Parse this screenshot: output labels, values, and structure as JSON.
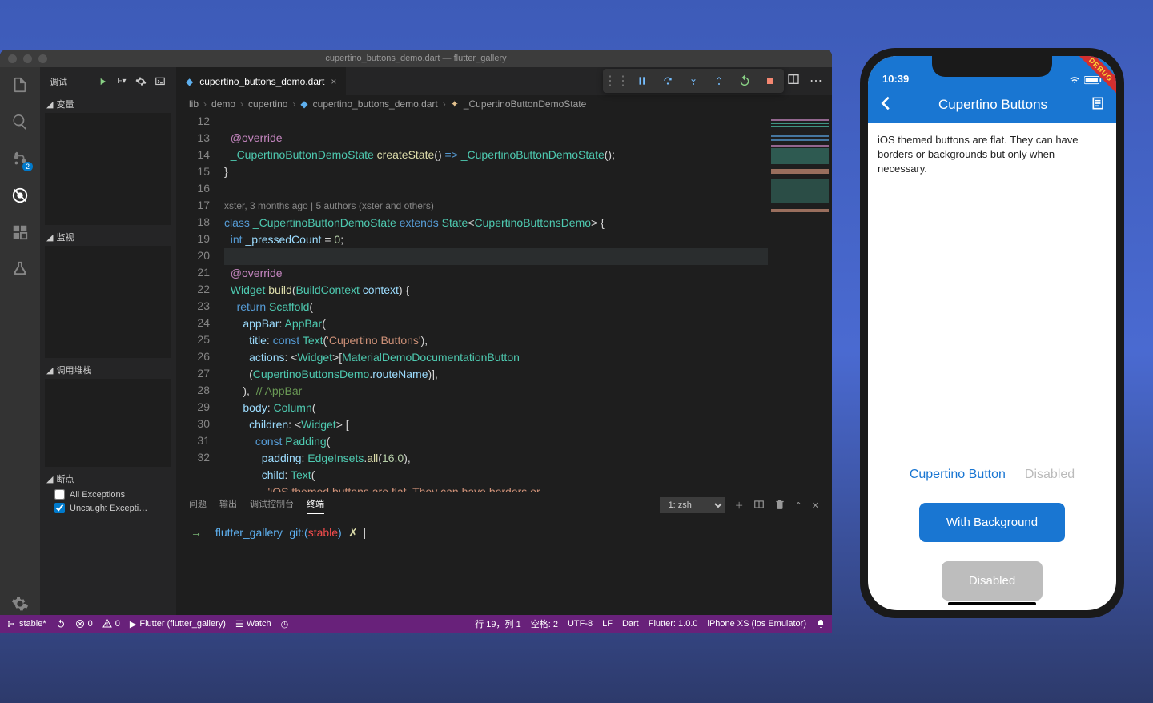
{
  "window": {
    "title": "cupertino_buttons_demo.dart — flutter_gallery"
  },
  "activitybar": {
    "scm_badge": "2"
  },
  "debug_sidebar": {
    "title": "调试",
    "sections": {
      "variables": "变量",
      "watch": "监视",
      "callstack": "调用堆栈",
      "breakpoints": "断点"
    },
    "breakpoint_items": [
      {
        "label": "All Exceptions",
        "checked": false
      },
      {
        "label": "Uncaught Excepti…",
        "checked": true
      }
    ]
  },
  "tab": {
    "filename": "cupertino_buttons_demo.dart"
  },
  "breadcrumbs": [
    "lib",
    "demo",
    "cupertino",
    "cupertino_buttons_demo.dart",
    "_CupertinoButtonDemoState"
  ],
  "codelens": "xster, 3 months ago | 5 authors (xster and others)",
  "code_lines": [
    {
      "n": 12,
      "html": ""
    },
    {
      "n": 13,
      "html": "  <span class='an'>@override</span>"
    },
    {
      "n": 14,
      "html": "  <span class='cls'>_CupertinoButtonDemoState</span> <span class='fn'>createState</span><span class='pn'>()</span> <span class='k'>=></span> <span class='cls'>_CupertinoButtonDemoState</span><span class='pn'>();</span>"
    },
    {
      "n": 15,
      "html": "<span class='pn'>}</span>"
    },
    {
      "n": 16,
      "html": ""
    },
    {
      "n": "lens",
      "html": "<span class='lens'>xster, 3 months ago | 5 authors (xster and others)</span>"
    },
    {
      "n": 17,
      "html": "<span class='k'>class</span> <span class='cls'>_CupertinoButtonDemoState</span> <span class='k'>extends</span> <span class='cls'>State</span><span class='pn'>&lt;</span><span class='cls'>CupertinoButtonsDemo</span><span class='pn'>&gt;</span> <span class='pn'>{</span>"
    },
    {
      "n": 18,
      "html": "  <span class='k'>int</span> <span class='id'>_pressedCount</span> <span class='pn'>=</span> <span class='num'>0</span><span class='pn'>;</span>"
    },
    {
      "n": 19,
      "html": "",
      "cursor": true
    },
    {
      "n": 20,
      "html": "  <span class='an'>@override</span>"
    },
    {
      "n": 21,
      "html": "  <span class='cls'>Widget</span> <span class='fn'>build</span><span class='pn'>(</span><span class='cls'>BuildContext</span> <span class='id'>context</span><span class='pn'>)</span> <span class='pn'>{</span>"
    },
    {
      "n": 22,
      "html": "    <span class='k'>return</span> <span class='cls'>Scaffold</span><span class='pn'>(</span>"
    },
    {
      "n": 23,
      "html": "      <span class='id'>appBar</span><span class='pn'>:</span> <span class='cls'>AppBar</span><span class='pn'>(</span>"
    },
    {
      "n": 24,
      "html": "        <span class='id'>title</span><span class='pn'>:</span> <span class='k'>const</span> <span class='cls'>Text</span><span class='pn'>(</span><span class='str'>'Cupertino Buttons'</span><span class='pn'>),</span>"
    },
    {
      "n": 25,
      "html": "        <span class='id'>actions</span><span class='pn'>:</span> <span class='pn'>&lt;</span><span class='cls'>Widget</span><span class='pn'>&gt;[</span><span class='cls'>MaterialDemoDocumentationButton</span>"
    },
    {
      "n": "",
      "html": "        <span class='pn'>(</span><span class='cls'>CupertinoButtonsDemo</span><span class='pn'>.</span><span class='id'>routeName</span><span class='pn'>)],</span>"
    },
    {
      "n": 26,
      "html": "      <span class='pn'>),</span>  <span class='cmt'>// AppBar</span>"
    },
    {
      "n": 27,
      "html": "      <span class='id'>body</span><span class='pn'>:</span> <span class='cls'>Column</span><span class='pn'>(</span>"
    },
    {
      "n": 28,
      "html": "        <span class='id'>children</span><span class='pn'>:</span> <span class='pn'>&lt;</span><span class='cls'>Widget</span><span class='pn'>&gt;</span> <span class='pn'>[</span>"
    },
    {
      "n": 29,
      "html": "          <span class='k'>const</span> <span class='cls'>Padding</span><span class='pn'>(</span>"
    },
    {
      "n": 30,
      "html": "            <span class='id'>padding</span><span class='pn'>:</span> <span class='cls'>EdgeInsets</span><span class='pn'>.</span><span class='fn'>all</span><span class='pn'>(</span><span class='num'>16.0</span><span class='pn'>),</span>"
    },
    {
      "n": 31,
      "html": "            <span class='id'>child</span><span class='pn'>:</span> <span class='cls'>Text</span><span class='pn'>(</span>"
    },
    {
      "n": 32,
      "html": "              <span class='str'>'iOS themed buttons are flat. They can have borders or </span>"
    }
  ],
  "terminal": {
    "tabs": [
      "问题",
      "输出",
      "调试控制台",
      "终端"
    ],
    "active_tab": "终端",
    "select": "1: zsh",
    "prompt_arrow": "→",
    "prompt_dir": "flutter_gallery",
    "prompt_git_pre": "git:(",
    "prompt_branch": "stable",
    "prompt_git_post": ")",
    "prompt_x": "✗"
  },
  "statusbar": {
    "branch": "stable*",
    "errors": "0",
    "warnings": "0",
    "flutter_target": "Flutter (flutter_gallery)",
    "watch": "Watch",
    "ln_col": "行 19，列 1",
    "spaces": "空格: 2",
    "encoding": "UTF-8",
    "eol": "LF",
    "lang": "Dart",
    "flutter_ver": "Flutter: 1.0.0",
    "device": "iPhone XS (ios Emulator)"
  },
  "phone": {
    "time": "10:39",
    "debug_label": "DEBUG",
    "appbar_title": "Cupertino Buttons",
    "body_text": "iOS themed buttons are flat. They can have borders or backgrounds but only when necessary.",
    "buttons": {
      "flat": "Cupertino Button",
      "flat_disabled": "Disabled",
      "bg": "With Background",
      "bg_disabled": "Disabled"
    }
  }
}
